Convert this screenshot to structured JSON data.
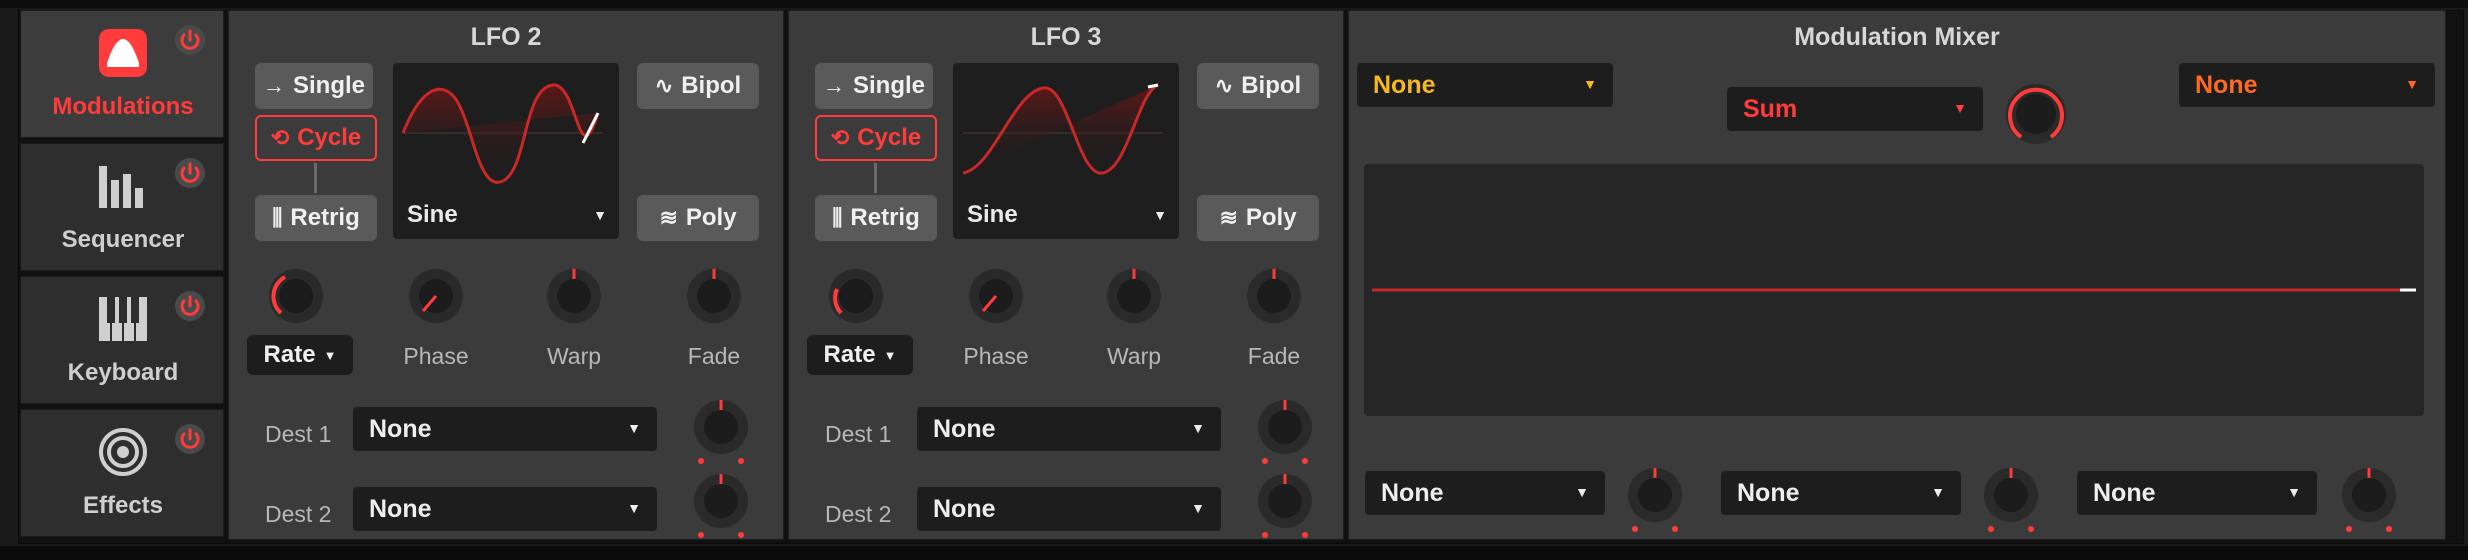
{
  "sidebar": {
    "items": [
      {
        "label": "Modulations",
        "icon": "modulations-icon",
        "active": true
      },
      {
        "label": "Sequencer",
        "icon": "sequencer-bars-icon",
        "active": false
      },
      {
        "label": "Keyboard",
        "icon": "keyboard-icon",
        "active": false
      },
      {
        "label": "Effects",
        "icon": "target-rings-icon",
        "active": false
      }
    ]
  },
  "lfo2": {
    "title": "LFO 2",
    "single_label": "Single",
    "cycle_label": "Cycle",
    "retrig_label": "Retrig",
    "bipol_label": "Bipol",
    "poly_label": "Poly",
    "waveform": "Sine",
    "rate_label": "Rate",
    "phase_label": "Phase",
    "warp_label": "Warp",
    "fade_label": "Fade",
    "dest1_label": "Dest 1",
    "dest1_value": "None",
    "dest2_label": "Dest 2",
    "dest2_value": "None"
  },
  "lfo3": {
    "title": "LFO 3",
    "single_label": "Single",
    "cycle_label": "Cycle",
    "retrig_label": "Retrig",
    "bipol_label": "Bipol",
    "poly_label": "Poly",
    "waveform": "Sine",
    "rate_label": "Rate",
    "phase_label": "Phase",
    "warp_label": "Warp",
    "fade_label": "Fade",
    "dest1_label": "Dest 1",
    "dest1_value": "None",
    "dest2_label": "Dest 2",
    "dest2_value": "None"
  },
  "mixer": {
    "title": "Modulation Mixer",
    "source_a": "None",
    "operator": "Sum",
    "source_b": "None",
    "target_1": "None",
    "target_2": "None",
    "target_3": "None"
  },
  "colors": {
    "accent_red": "#ff3b3b",
    "source_yellow": "#f6b81c",
    "source_orange": "#ff6a1f",
    "panel_bg": "#3b3b3b"
  }
}
